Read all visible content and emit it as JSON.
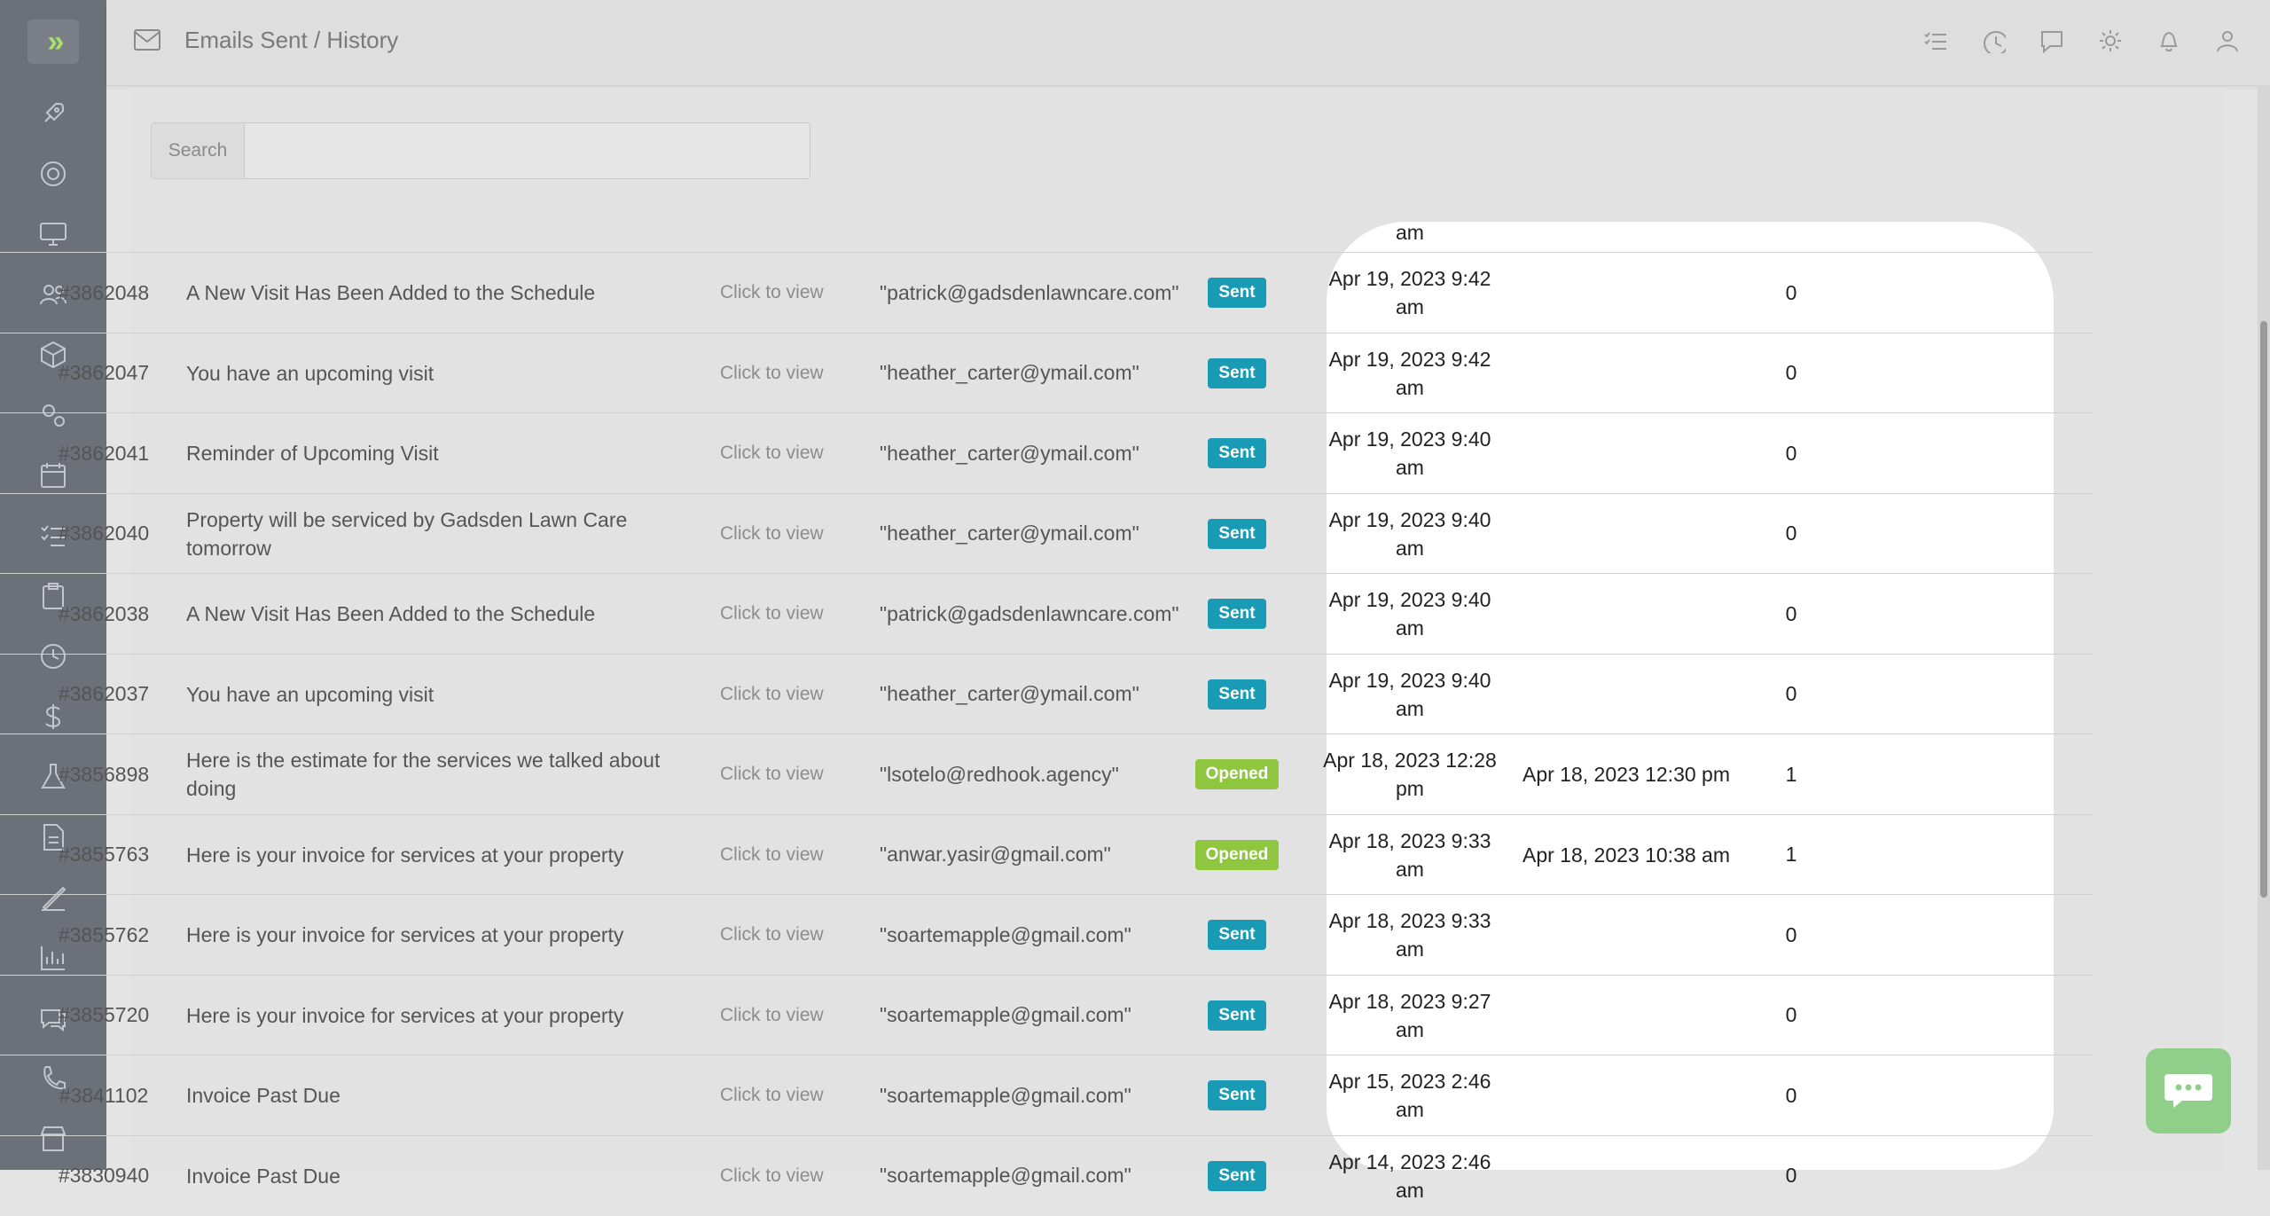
{
  "header": {
    "title": "Emails Sent / History",
    "icons": [
      "checklist-icon",
      "clock-icon",
      "message-icon",
      "gear-icon",
      "bell-icon",
      "user-icon"
    ]
  },
  "sidebar": {
    "items": [
      "rocket-icon",
      "lifebuoy-icon",
      "monitor-icon",
      "users-icon",
      "box-icon",
      "gears-icon",
      "calendar-icon",
      "list-check-icon",
      "clipboard-icon",
      "clock-icon",
      "dollar-icon",
      "flask-icon",
      "document-icon",
      "signature-icon",
      "chart-icon",
      "chat-icon",
      "phone-icon",
      "store-icon"
    ]
  },
  "search": {
    "label": "Search",
    "value": ""
  },
  "table": {
    "view_label": "Click to view",
    "partial_top_time": "am",
    "rows": [
      {
        "id": "#3862048",
        "subject": "A New Visit Has Been Added to the Schedule",
        "to": "\"patrick@gadsdenlawncare.com\"",
        "status": "Sent",
        "sent": "Apr 19, 2023 9:42 am",
        "opened": "",
        "count": "0"
      },
      {
        "id": "#3862047",
        "subject": "You have an upcoming visit",
        "to": "\"heather_carter@ymail.com\"",
        "status": "Sent",
        "sent": "Apr 19, 2023 9:42 am",
        "opened": "",
        "count": "0"
      },
      {
        "id": "#3862041",
        "subject": "Reminder of Upcoming Visit",
        "to": "\"heather_carter@ymail.com\"",
        "status": "Sent",
        "sent": "Apr 19, 2023 9:40 am",
        "opened": "",
        "count": "0"
      },
      {
        "id": "#3862040",
        "subject": "Property will be serviced by Gadsden Lawn Care tomorrow",
        "to": "\"heather_carter@ymail.com\"",
        "status": "Sent",
        "sent": "Apr 19, 2023 9:40 am",
        "opened": "",
        "count": "0"
      },
      {
        "id": "#3862038",
        "subject": "A New Visit Has Been Added to the Schedule",
        "to": "\"patrick@gadsdenlawncare.com\"",
        "status": "Sent",
        "sent": "Apr 19, 2023 9:40 am",
        "opened": "",
        "count": "0"
      },
      {
        "id": "#3862037",
        "subject": "You have an upcoming visit",
        "to": "\"heather_carter@ymail.com\"",
        "status": "Sent",
        "sent": "Apr 19, 2023 9:40 am",
        "opened": "",
        "count": "0"
      },
      {
        "id": "#3856898",
        "subject": "Here is the estimate for the services we talked about doing",
        "to": "\"lsotelo@redhook.agency\"",
        "status": "Opened",
        "sent": "Apr 18, 2023 12:28 pm",
        "opened": "Apr 18, 2023 12:30 pm",
        "count": "1"
      },
      {
        "id": "#3855763",
        "subject": "Here is your invoice for services at your property",
        "to": "\"anwar.yasir@gmail.com\"",
        "status": "Opened",
        "sent": "Apr 18, 2023 9:33 am",
        "opened": "Apr 18, 2023 10:38 am",
        "count": "1"
      },
      {
        "id": "#3855762",
        "subject": "Here is your invoice for services at your property",
        "to": "\"soartemapple@gmail.com\"",
        "status": "Sent",
        "sent": "Apr 18, 2023 9:33 am",
        "opened": "",
        "count": "0"
      },
      {
        "id": "#3855720",
        "subject": "Here is your invoice for services at your property",
        "to": "\"soartemapple@gmail.com\"",
        "status": "Sent",
        "sent": "Apr 18, 2023 9:27 am",
        "opened": "",
        "count": "0"
      },
      {
        "id": "#3841102",
        "subject": "Invoice Past Due",
        "to": "\"soartemapple@gmail.com\"",
        "status": "Sent",
        "sent": "Apr 15, 2023 2:46 am",
        "opened": "",
        "count": "0"
      },
      {
        "id": "#3830940",
        "subject": "Invoice Past Due",
        "to": "\"soartemapple@gmail.com\"",
        "status": "Sent",
        "sent": "Apr 14, 2023 2:46 am",
        "opened": "",
        "count": "0"
      }
    ]
  },
  "colors": {
    "sent": "#1a9bb5",
    "opened": "#8ec63f",
    "sidebar": "#6c7078",
    "accent": "#a8e26a"
  },
  "chat": {
    "icon": "chat-bubble-icon"
  }
}
